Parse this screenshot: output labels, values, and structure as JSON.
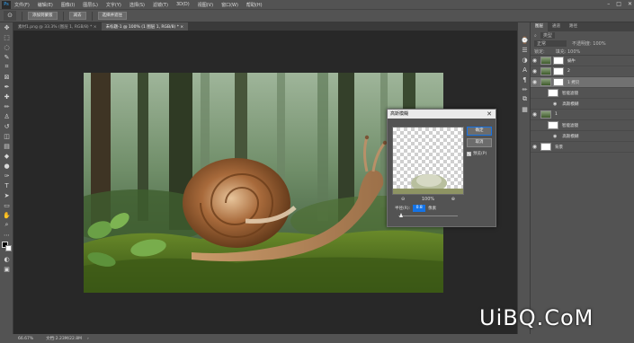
{
  "menu": {
    "logo": "Ps",
    "items": [
      "文件(F)",
      "编辑(E)",
      "图像(I)",
      "图层(L)",
      "文字(Y)",
      "选择(S)",
      "滤镜(T)",
      "3D(D)",
      "视图(V)",
      "窗口(W)",
      "帮助(H)"
    ],
    "window_controls": [
      "–",
      "□",
      "✕"
    ]
  },
  "options": {
    "buttons": [
      "添加到蒙版",
      "减去",
      "选择并遮住"
    ]
  },
  "tabs": [
    {
      "label": "素材1.png @ 33.3% (图层 1, RGB/8) *  ×",
      "active": false
    },
    {
      "label": "未标题-1 @ 100% (1 图层 1, RGB/8) *  ×",
      "active": true
    }
  ],
  "statusbar": {
    "zoom": "66.67%",
    "doc": "文档:2.23M/22.8M",
    "arrow": "›"
  },
  "panel": {
    "tabs": [
      "图层",
      "通道",
      "路径"
    ],
    "kind": "类型",
    "mode": "正常",
    "opacity_label": "不透明度: 100%",
    "lock_label": "锁定:",
    "fill_label": "填充: 100%",
    "layers": [
      {
        "name": "蜗牛",
        "kind": "image",
        "indent": 0
      },
      {
        "name": "2",
        "kind": "image",
        "indent": 0
      },
      {
        "name": "1 拷贝",
        "kind": "image",
        "indent": 0,
        "selected": true
      },
      {
        "name": "智能滤镜",
        "kind": "filter",
        "indent": 1
      },
      {
        "name": "高斯模糊",
        "kind": "effect",
        "indent": 2
      },
      {
        "name": "1",
        "kind": "image",
        "indent": 0
      },
      {
        "name": "智能滤镜",
        "kind": "filter",
        "indent": 1
      },
      {
        "name": "高斯模糊",
        "kind": "effect",
        "indent": 2
      },
      {
        "name": "背景",
        "kind": "bg",
        "indent": 0
      }
    ]
  },
  "dialog": {
    "title": "高斯模糊",
    "close": "✕",
    "ok": "确定",
    "cancel": "取消",
    "preview_label": "预览(P)",
    "zoom": "100%",
    "zoom_out": "⊖",
    "zoom_in": "⊕",
    "radius_label": "半径(R):",
    "radius_value": "0.8",
    "radius_unit": "像素",
    "preview_checked": true,
    "slider_fraction": 0.05
  },
  "watermark": "UiBQ.CoM",
  "colors": {
    "ui_panel": "#535353",
    "canvas_bg": "#282828",
    "selected_layer": "#717171",
    "accent_blue": "#1473e6",
    "watermark": "#ffffff"
  }
}
